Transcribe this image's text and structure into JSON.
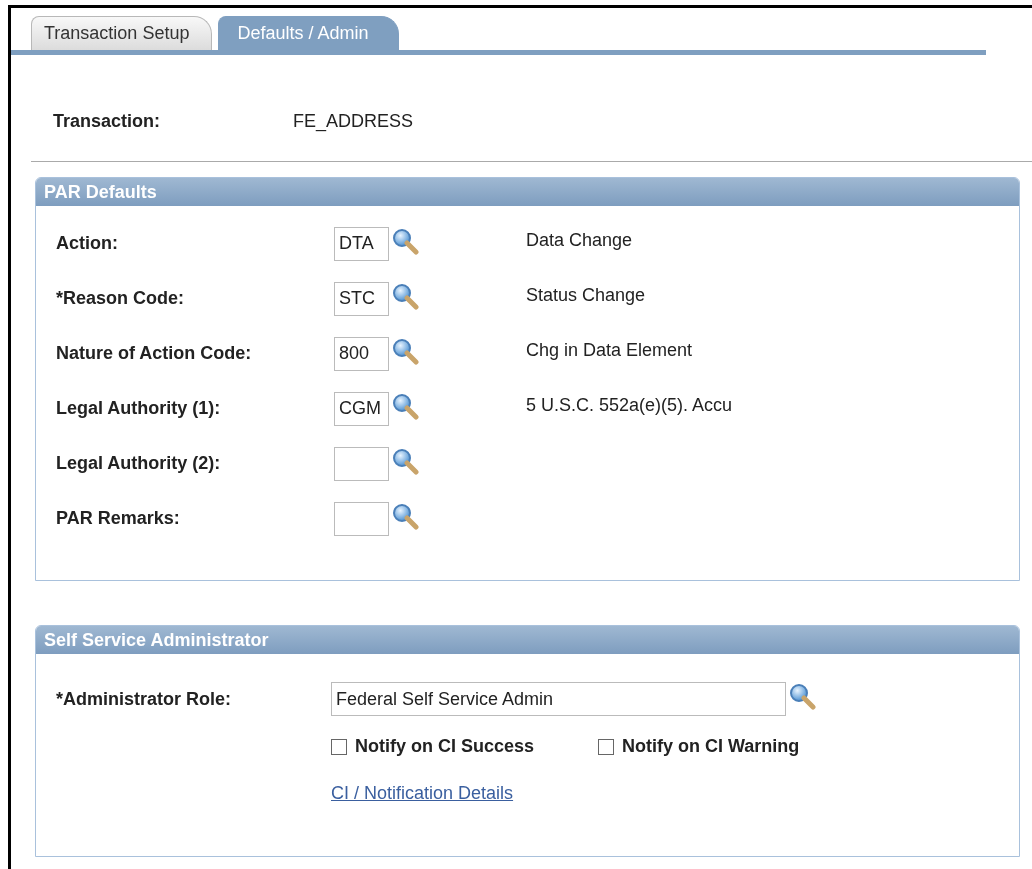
{
  "tabs": [
    {
      "label": "Transaction Setup",
      "selected": false
    },
    {
      "label": "Defaults / Admin",
      "selected": true
    }
  ],
  "transaction": {
    "label": "Transaction:",
    "value": "FE_ADDRESS"
  },
  "par_defaults": {
    "title": "PAR Defaults",
    "rows": [
      {
        "label": "Action:",
        "value": "DTA",
        "description": "Data Change"
      },
      {
        "label": "*Reason Code:",
        "value": "STC",
        "description": "Status Change"
      },
      {
        "label": "Nature of Action Code:",
        "value": "800",
        "description": "Chg in Data Element"
      },
      {
        "label": "Legal Authority (1):",
        "value": "CGM",
        "description": "5 U.S.C. 552a(e)(5). Accu"
      },
      {
        "label": "Legal Authority (2):"
      },
      {
        "label": "PAR Remarks:"
      }
    ]
  },
  "self_service": {
    "title": "Self Service Administrator",
    "role_label": "*Administrator Role:",
    "role_value": "Federal Self Service Admin",
    "checkboxes": [
      {
        "label": "Notify on CI Success",
        "checked": false
      },
      {
        "label": "Notify on CI Warning",
        "checked": false
      }
    ],
    "link": "CI / Notification Details"
  }
}
